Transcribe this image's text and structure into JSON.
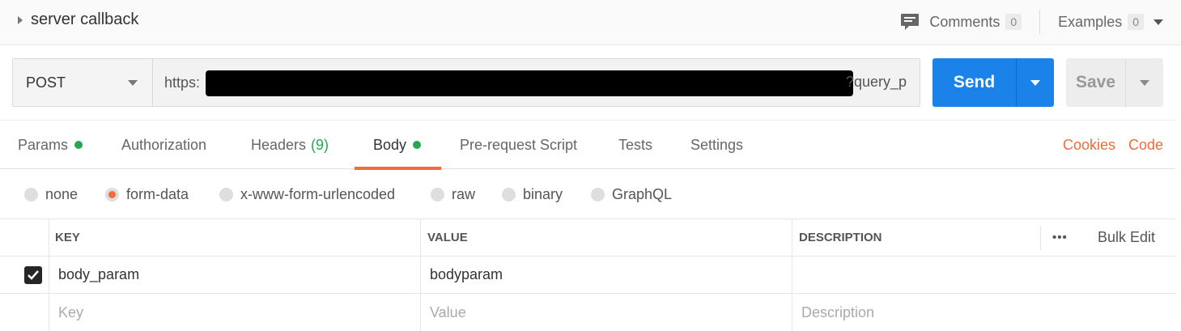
{
  "request": {
    "name": "server callback"
  },
  "header": {
    "comments_label": "Comments",
    "comments_count": "0",
    "examples_label": "Examples",
    "examples_count": "0"
  },
  "urlbar": {
    "method": "POST",
    "url_prefix": "https:",
    "url_suffix": "?query_p",
    "send_label": "Send",
    "save_label": "Save"
  },
  "tabs": [
    {
      "label": "Params",
      "count": "",
      "dot": true
    },
    {
      "label": "Authorization",
      "count": "",
      "dot": false
    },
    {
      "label": "Headers",
      "count": "(9)",
      "dot": false
    },
    {
      "label": "Body",
      "count": "",
      "dot": true,
      "active": true
    },
    {
      "label": "Pre-request Script",
      "count": "",
      "dot": false
    },
    {
      "label": "Tests",
      "count": "",
      "dot": false
    },
    {
      "label": "Settings",
      "count": "",
      "dot": false
    }
  ],
  "tab_links": {
    "cookies": "Cookies",
    "code": "Code"
  },
  "body_types": [
    {
      "label": "none",
      "selected": false
    },
    {
      "label": "form-data",
      "selected": true
    },
    {
      "label": "x-www-form-urlencoded",
      "selected": false
    },
    {
      "label": "raw",
      "selected": false
    },
    {
      "label": "binary",
      "selected": false
    },
    {
      "label": "GraphQL",
      "selected": false
    }
  ],
  "table": {
    "columns": {
      "key": "KEY",
      "value": "VALUE",
      "description": "DESCRIPTION"
    },
    "more": "•••",
    "bulk_edit": "Bulk Edit",
    "rows": [
      {
        "checked": true,
        "key": "body_param",
        "value": "bodyparam",
        "description": ""
      }
    ],
    "placeholders": {
      "key": "Key",
      "value": "Value",
      "description": "Description"
    }
  },
  "colors": {
    "accent": "#f26b3a",
    "send": "#1a82e8",
    "dot": "#26a755"
  }
}
